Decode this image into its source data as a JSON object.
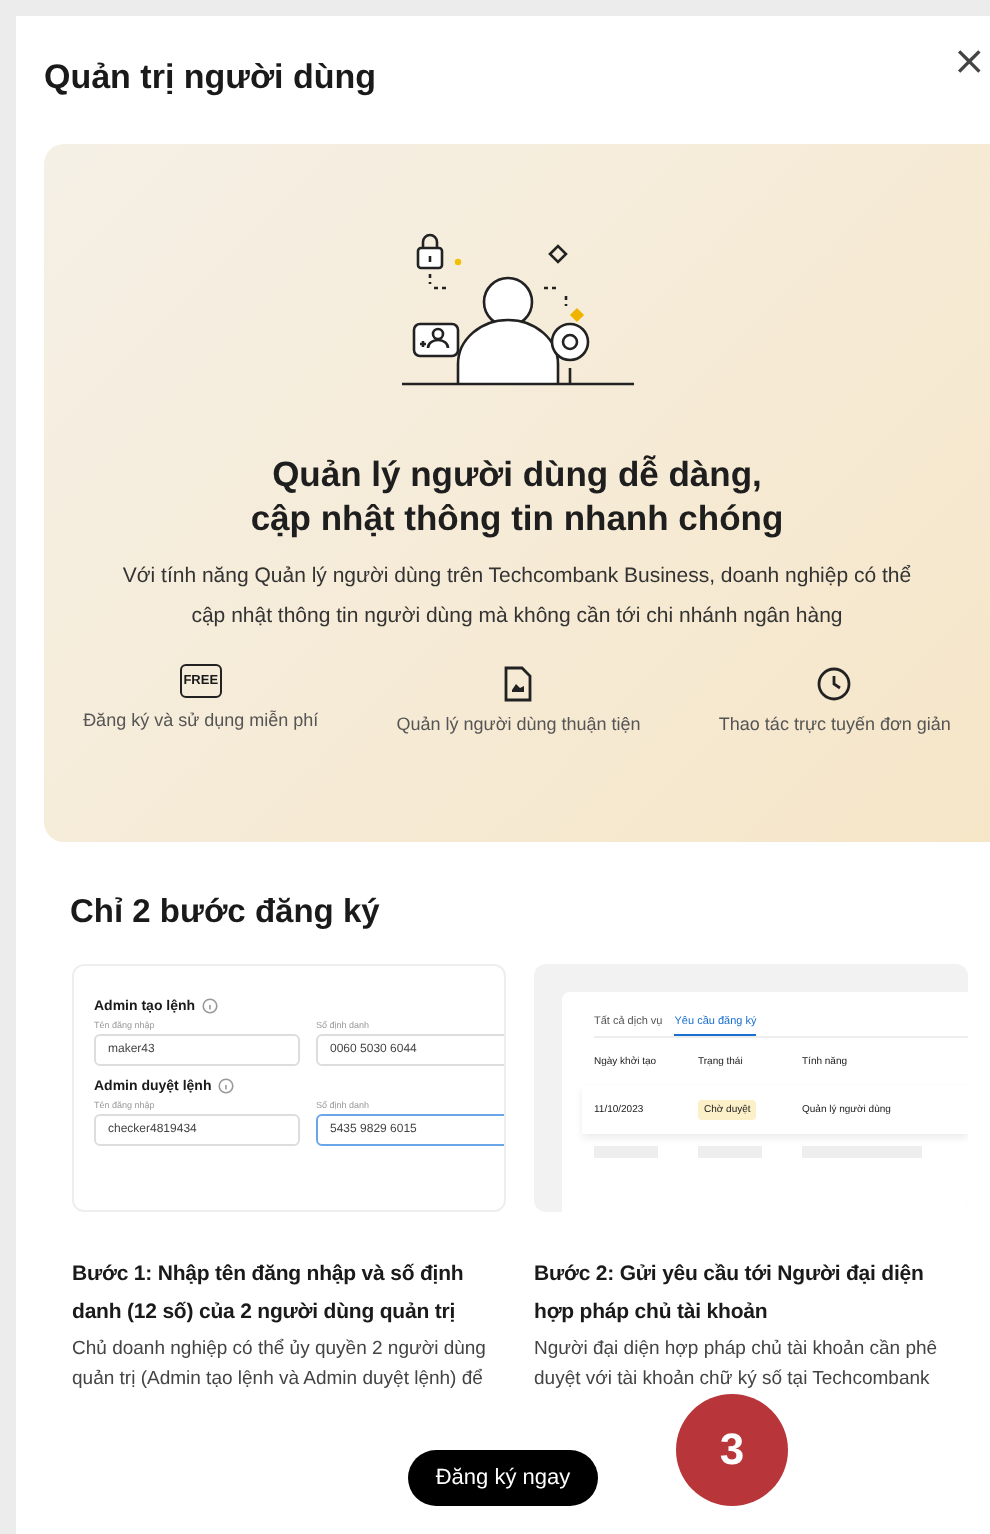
{
  "dialog": {
    "title": "Quản trị người dùng",
    "close": "×"
  },
  "hero": {
    "headline": [
      "Quản lý người dùng dễ dàng,",
      "cập nhật thông tin nhanh chóng"
    ],
    "description": "Với tính năng Quản lý người dùng trên Techcombank Business, doanh nghiệp có thể cập nhật thông tin người dùng mà không cần tới chi nhánh ngân hàng",
    "features": [
      {
        "kind": "free",
        "icon_text": "FREE",
        "label": "Đăng ký và sử dụng miễn phí"
      },
      {
        "kind": "document",
        "label": "Quản lý người dùng thuận tiện"
      },
      {
        "kind": "clock",
        "label": "Thao tác trực tuyến đơn giản"
      }
    ]
  },
  "steps_title": "Chỉ 2 bước đăng ký",
  "steps": [
    {
      "kind": "form",
      "preview": {
        "groups": [
          {
            "title": "Admin tạo lệnh",
            "fields": [
              {
                "label": "Tên đăng nhập",
                "value": "maker43",
                "focused": false
              },
              {
                "label": "Số định danh",
                "value": "0060 5030 6044",
                "focused": false
              }
            ]
          },
          {
            "title": "Admin duyệt lệnh",
            "fields": [
              {
                "label": "Tên đăng nhập",
                "value": "checker4819434",
                "focused": false
              },
              {
                "label": "Số định danh",
                "value": "5435 9829 6015",
                "focused": true
              }
            ]
          }
        ]
      },
      "title": "Bước 1: Nhập tên đăng nhập và số định danh (12 số) của 2 người dùng quản trị",
      "body": "Chủ doanh nghiệp có thể ủy quyền 2 người dùng quản trị (Admin tạo lệnh và Admin duyệt lệnh) để"
    },
    {
      "kind": "table",
      "preview": {
        "tabs": [
          {
            "label": "Tất cả dịch vụ",
            "selected": false
          },
          {
            "label": "Yêu cầu đăng ký",
            "selected": true
          }
        ],
        "columns": [
          "Ngày khởi tạo",
          "Trạng thái",
          "Tính năng"
        ],
        "rows": [
          {
            "date": "11/10/2023",
            "status": "Chờ duyệt",
            "feature": "Quản lý người dùng"
          }
        ]
      },
      "title": "Bước 2: Gửi yêu cầu tới Người đại diện hợp pháp chủ tài khoản",
      "body": "Người đại diện hợp pháp chủ tài khoản cần phê duyệt với tài khoản chữ ký số tại Techcombank"
    }
  ],
  "primary_button": "Đăng ký ngay",
  "step_badge": "3"
}
